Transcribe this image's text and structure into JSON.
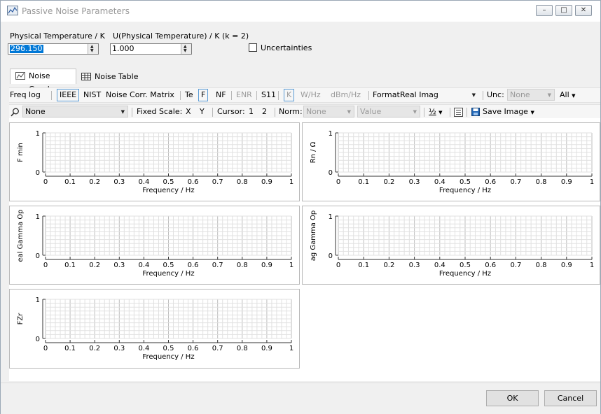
{
  "window": {
    "title": "Passive Noise Parameters",
    "buttons": {
      "minimize": "–",
      "maximize": "□",
      "close": "✕"
    },
    "icon": "chart-window-icon"
  },
  "params": {
    "temperature_label": "Physical Temperature / K",
    "temperature_value": "296.150",
    "uncertainty_label": "U(Physical Temperature) / K (k = 2)",
    "uncertainty_value": "1.000",
    "uncertainties_checkbox_label": "Uncertainties",
    "uncertainties_checked": false
  },
  "tabs": [
    {
      "label": "Noise Graph",
      "icon": "graph-icon",
      "active": true
    },
    {
      "label": "Noise Table",
      "icon": "table-icon",
      "active": false
    }
  ],
  "toolbar1": {
    "freq_log": "Freq log",
    "ieee": "IEEE",
    "nist": "NIST",
    "noise_corr": "Noise Corr. Matrix",
    "te": "Te",
    "f": "F",
    "nf": "NF",
    "enr": "ENR",
    "s11": "S11",
    "k": "K",
    "whz": "W/Hz",
    "dbmhz": "dBm/Hz",
    "format_label": "Format:",
    "format_value": "Real Imag",
    "unc_label": "Unc:",
    "unc_value": "None",
    "all": "All"
  },
  "toolbar2": {
    "search_value": "None",
    "fixed_scale": "Fixed Scale:",
    "x": "X",
    "y": "Y",
    "cursor_label": "Cursor:",
    "cursor1": "1",
    "cursor2": "2",
    "norm_label": "Norm:",
    "norm_value": "None",
    "value_combo": "Value",
    "save_image": "Save Image"
  },
  "graphs": [
    {
      "ylabel": "F min",
      "xlabel": "Frequency / Hz"
    },
    {
      "ylabel": "Rn / Ω",
      "xlabel": "Frequency / Hz"
    },
    {
      "ylabel": "eal Gamma Op",
      "xlabel": "Frequency / Hz"
    },
    {
      "ylabel": "ag Gamma Op",
      "xlabel": "Frequency / Hz"
    },
    {
      "ylabel": "FZr",
      "xlabel": "Frequency / Hz"
    }
  ],
  "axis": {
    "xticks": [
      "0",
      "0.1",
      "0.2",
      "0.3",
      "0.4",
      "0.5",
      "0.6",
      "0.7",
      "0.8",
      "0.9",
      "1"
    ],
    "yticks": [
      "0",
      "1"
    ]
  },
  "footer": {
    "ok": "OK",
    "cancel": "Cancel"
  }
}
